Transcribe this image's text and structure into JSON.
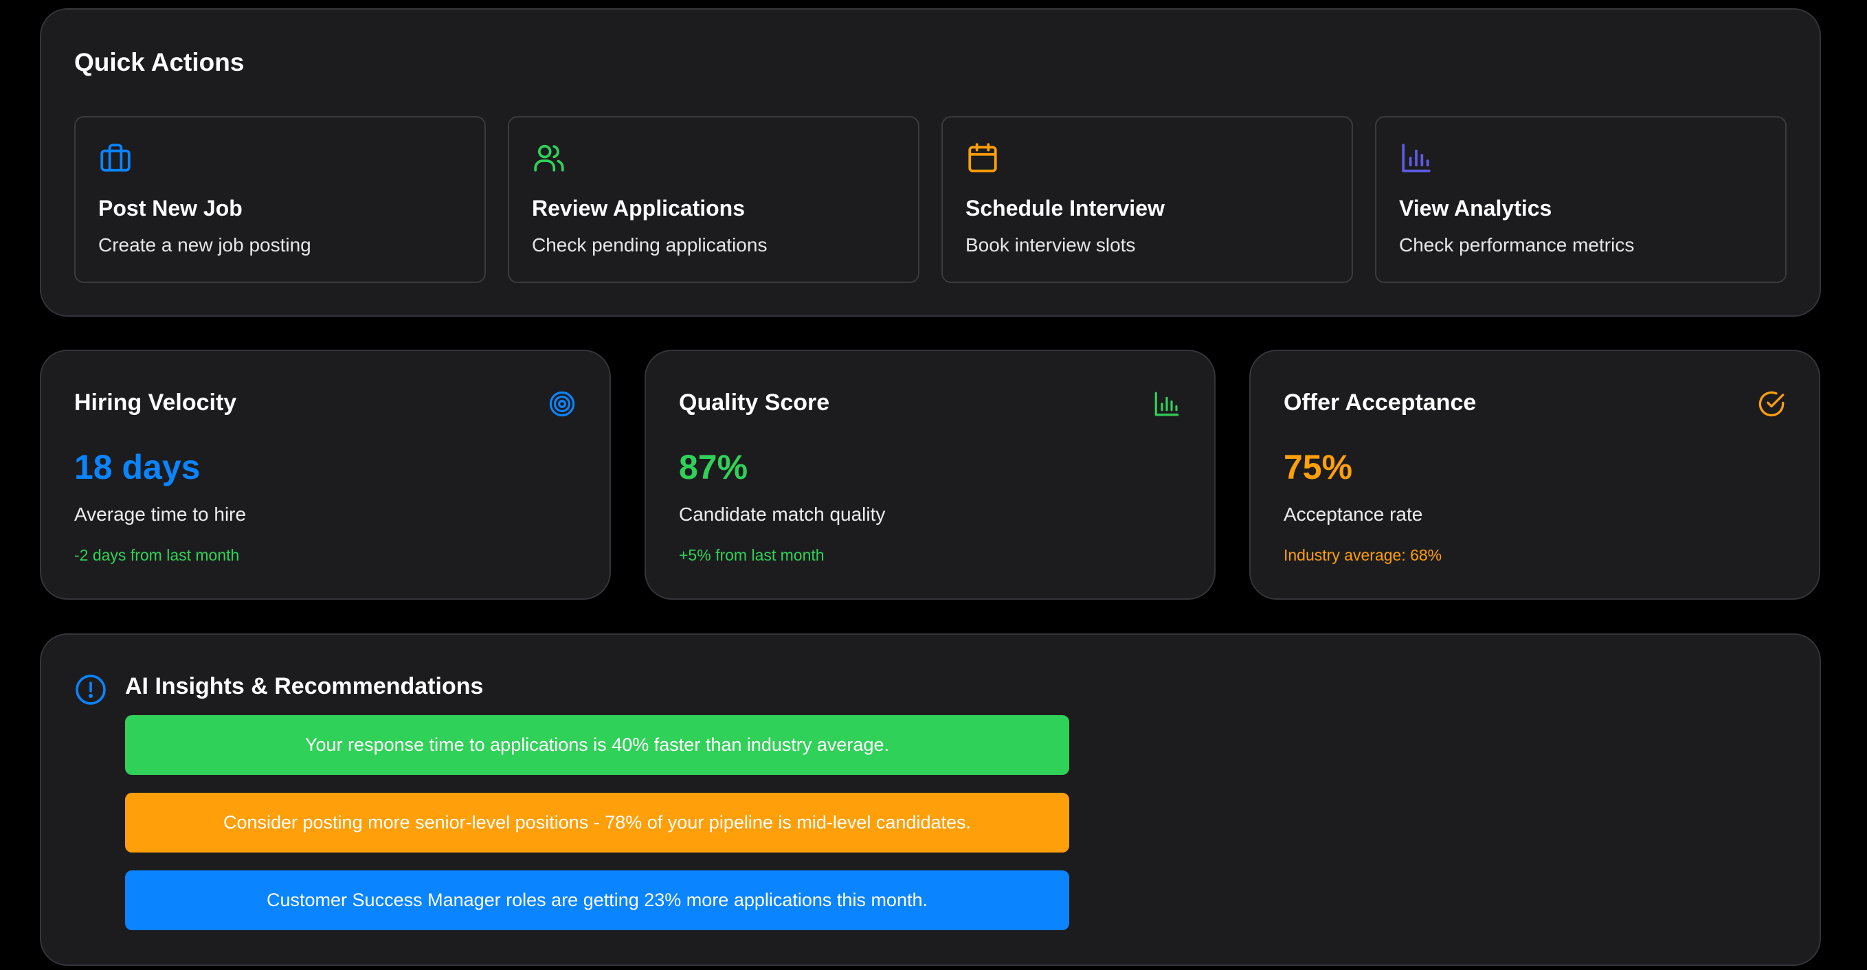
{
  "quick_actions": {
    "title": "Quick Actions",
    "cards": [
      {
        "title": "Post New Job",
        "description": "Create a new job posting",
        "icon": "briefcase-icon",
        "color": "#0a84ff"
      },
      {
        "title": "Review Applications",
        "description": "Check pending applications",
        "icon": "users-icon",
        "color": "#30d158"
      },
      {
        "title": "Schedule Interview",
        "description": "Book interview slots",
        "icon": "calendar-icon",
        "color": "#ff9f0a"
      },
      {
        "title": "View Analytics",
        "description": "Check performance metrics",
        "icon": "bar-chart-icon",
        "color": "#5e5ce6"
      }
    ]
  },
  "metrics": [
    {
      "title": "Hiring Velocity",
      "value": "18 days",
      "label": "Average time to hire",
      "note": "-2 days from last month",
      "icon": "target-icon",
      "value_color": "#0a84ff",
      "note_color": "#30d158"
    },
    {
      "title": "Quality Score",
      "value": "87%",
      "label": "Candidate match quality",
      "note": "+5% from last month",
      "icon": "bar-chart-icon",
      "value_color": "#30d158",
      "note_color": "#30d158"
    },
    {
      "title": "Offer Acceptance",
      "value": "75%",
      "label": "Acceptance rate",
      "note": "Industry average: 68%",
      "icon": "check-circle-icon",
      "value_color": "#ff9f0a",
      "note_color": "#ff9f0a"
    }
  ],
  "ai_insights": {
    "title": "AI Insights & Recommendations",
    "icon": "info-circle-icon",
    "items": [
      {
        "text": "Your response time to applications is 40% faster than industry average.",
        "color": "#30d158"
      },
      {
        "text": "Consider posting more senior-level positions - 78% of your pipeline is mid-level candidates.",
        "color": "#ff9f0a"
      },
      {
        "text": "Customer Success Manager roles are getting 23% more applications this month.",
        "color": "#0a84ff"
      }
    ]
  }
}
